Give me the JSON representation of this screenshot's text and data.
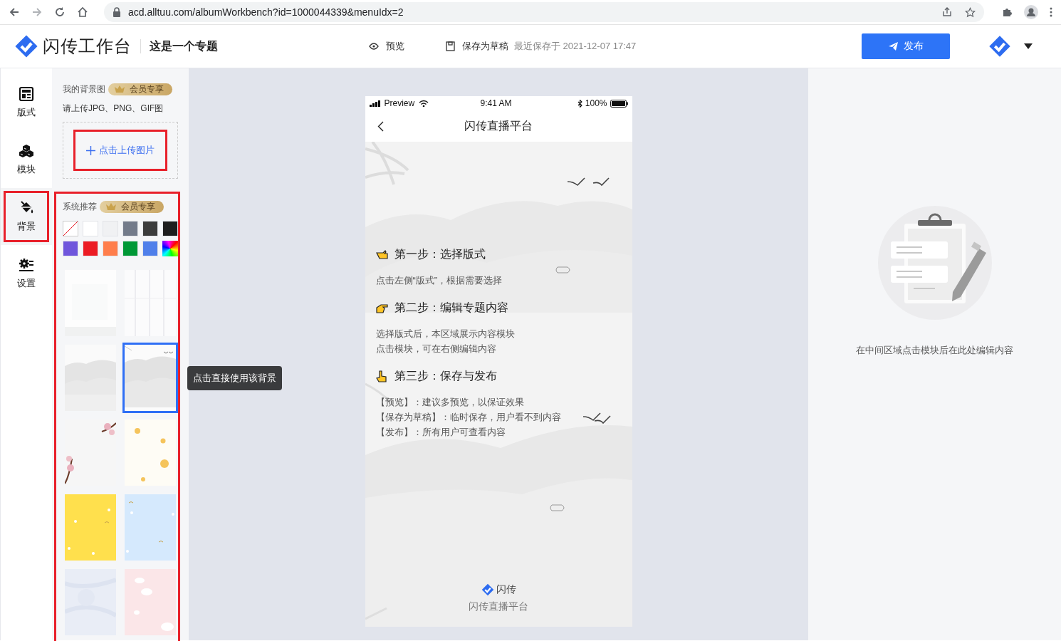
{
  "browser": {
    "url": "acd.alltuu.com/albumWorkbench?id=1000044339&menuIdx=2"
  },
  "header": {
    "app_name": "闪传工作台",
    "project_title": "这是一个专题",
    "preview": "预览",
    "save_draft": "保存为草稿",
    "last_saved": "最近保存于 2021-12-07 17:47",
    "publish": "发布"
  },
  "nav": [
    {
      "label": "版式",
      "selected": false,
      "highlighted": false
    },
    {
      "label": "模块",
      "selected": false,
      "highlighted": false
    },
    {
      "label": "背景",
      "selected": true,
      "highlighted": true
    },
    {
      "label": "设置",
      "selected": false,
      "highlighted": false
    }
  ],
  "my_backgrounds": {
    "title": "我的背景图",
    "badge": "会员专享",
    "hint": "请上传JPG、PNG、GIF图",
    "upload": {
      "label": "点击上传图片",
      "highlighted": true
    }
  },
  "recommended": {
    "title": "系统推荐",
    "badge": "会员专享",
    "highlighted": true,
    "swatches": [
      {
        "kind": "none",
        "color": "#ffffff"
      },
      {
        "kind": "solid",
        "color": "#ffffff"
      },
      {
        "kind": "solid",
        "color": "#f0f1f3"
      },
      {
        "kind": "solid",
        "color": "#737b8a"
      },
      {
        "kind": "solid",
        "color": "#3c3c3c"
      },
      {
        "kind": "solid",
        "color": "#1e1e1e"
      },
      {
        "kind": "solid",
        "color": "#6f56dc"
      },
      {
        "kind": "solid",
        "color": "#ec1c24"
      },
      {
        "kind": "solid",
        "color": "#ff7e4c"
      },
      {
        "kind": "solid",
        "color": "#009836"
      },
      {
        "kind": "solid",
        "color": "#4f7fea"
      },
      {
        "kind": "rainbow"
      }
    ],
    "thumbnails": [
      {
        "kind": "picture",
        "selected": false
      },
      {
        "kind": "picture",
        "selected": false
      },
      {
        "kind": "picture",
        "selected": false
      },
      {
        "kind": "picture",
        "selected": true
      },
      {
        "kind": "picture",
        "selected": false
      },
      {
        "kind": "picture",
        "selected": false
      },
      {
        "kind": "picture",
        "selected": false
      },
      {
        "kind": "picture",
        "selected": false
      },
      {
        "kind": "picture",
        "selected": false
      },
      {
        "kind": "picture",
        "selected": false
      }
    ],
    "tooltip": "点击直接使用该背景"
  },
  "phone": {
    "status": {
      "carrier": "Preview",
      "time": "9:41 AM",
      "battery": "100%"
    },
    "title": "闪传直播平台",
    "steps": [
      {
        "title": "第一步：选择版式",
        "lines": [
          "点击左侧“版式”，根据需要选择"
        ]
      },
      {
        "title": "第二步：编辑专题内容",
        "lines": [
          "选择版式后，本区域展示内容模块",
          "点击模块，可在右侧编辑内容"
        ]
      },
      {
        "title": "第三步：保存与发布",
        "lines": [
          "【预览】：建议多预览，以保证效果",
          "【保存为草稿】：临时保存，用户看不到内容",
          "【发布】：所有用户可查看内容"
        ]
      }
    ],
    "footer_brand": "闪传",
    "footer_text": "闪传直播平台"
  },
  "properties": {
    "hint": "在中间区域点击模块后在此处编辑内容"
  }
}
